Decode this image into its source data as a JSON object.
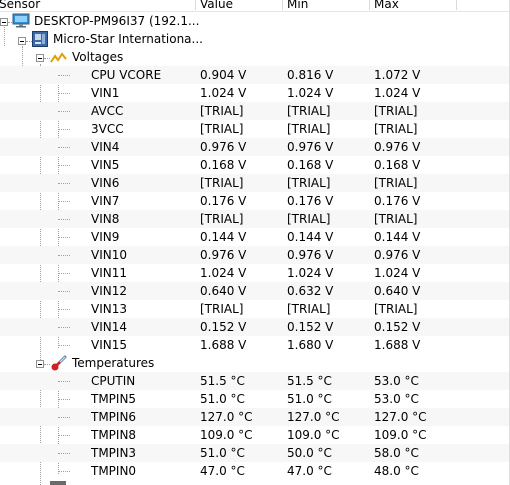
{
  "columns": {
    "sensor": "Sensor",
    "value": "Value",
    "min": "Min",
    "max": "Max"
  },
  "computer": {
    "label": "DESKTOP-PM96I37 (192.1...",
    "icon": "monitor-icon"
  },
  "board": {
    "label": "Micro-Star Internationa...",
    "icon": "motherboard-icon"
  },
  "voltages": {
    "label": "Voltages",
    "icon": "voltage-icon",
    "rows": [
      {
        "name": "CPU VCORE",
        "value": "0.904 V",
        "min": "0.816 V",
        "max": "1.072 V"
      },
      {
        "name": "VIN1",
        "value": "1.024 V",
        "min": "1.024 V",
        "max": "1.024 V"
      },
      {
        "name": "AVCC",
        "value": "[TRIAL]",
        "min": "[TRIAL]",
        "max": "[TRIAL]"
      },
      {
        "name": "3VCC",
        "value": "[TRIAL]",
        "min": "[TRIAL]",
        "max": "[TRIAL]"
      },
      {
        "name": "VIN4",
        "value": "0.976 V",
        "min": "0.976 V",
        "max": "0.976 V"
      },
      {
        "name": "VIN5",
        "value": "0.168 V",
        "min": "0.168 V",
        "max": "0.168 V"
      },
      {
        "name": "VIN6",
        "value": "[TRIAL]",
        "min": "[TRIAL]",
        "max": "[TRIAL]"
      },
      {
        "name": "VIN7",
        "value": "0.176 V",
        "min": "0.176 V",
        "max": "0.176 V"
      },
      {
        "name": "VIN8",
        "value": "[TRIAL]",
        "min": "[TRIAL]",
        "max": "[TRIAL]"
      },
      {
        "name": "VIN9",
        "value": "0.144 V",
        "min": "0.144 V",
        "max": "0.144 V"
      },
      {
        "name": "VIN10",
        "value": "0.976 V",
        "min": "0.976 V",
        "max": "0.976 V"
      },
      {
        "name": "VIN11",
        "value": "1.024 V",
        "min": "1.024 V",
        "max": "1.024 V"
      },
      {
        "name": "VIN12",
        "value": "0.640 V",
        "min": "0.632 V",
        "max": "0.640 V"
      },
      {
        "name": "VIN13",
        "value": "[TRIAL]",
        "min": "[TRIAL]",
        "max": "[TRIAL]"
      },
      {
        "name": "VIN14",
        "value": "0.152 V",
        "min": "0.152 V",
        "max": "0.152 V"
      },
      {
        "name": "VIN15",
        "value": "1.688 V",
        "min": "1.680 V",
        "max": "1.688 V"
      }
    ]
  },
  "temperatures": {
    "label": "Temperatures",
    "icon": "thermometer-icon",
    "rows": [
      {
        "name": "CPUTIN",
        "value": "51.5 °C",
        "min": "51.5 °C",
        "max": "53.0 °C"
      },
      {
        "name": "TMPIN5",
        "value": "51.0 °C",
        "min": "51.0 °C",
        "max": "53.0 °C"
      },
      {
        "name": "TMPIN6",
        "value": "127.0 °C",
        "min": "127.0 °C",
        "max": "127.0 °C"
      },
      {
        "name": "TMPIN8",
        "value": "109.0 °C",
        "min": "109.0 °C",
        "max": "109.0 °C"
      },
      {
        "name": "TMPIN3",
        "value": "51.0 °C",
        "min": "50.0 °C",
        "max": "58.0 °C"
      },
      {
        "name": "TMPIN0",
        "value": "47.0 °C",
        "min": "47.0 °C",
        "max": "48.0 °C"
      }
    ]
  }
}
